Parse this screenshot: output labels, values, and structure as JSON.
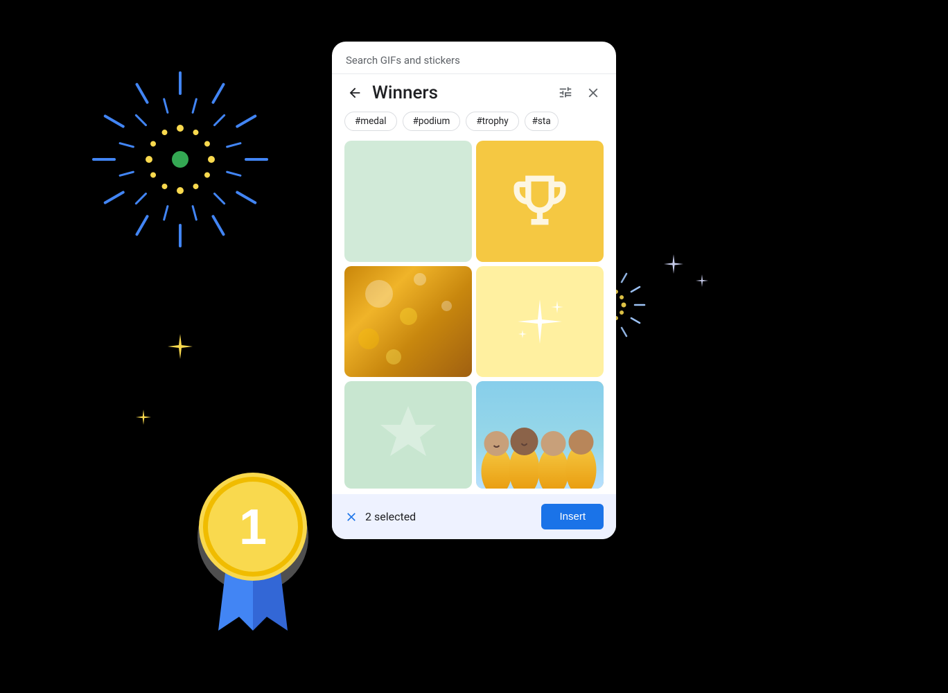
{
  "background": "#000000",
  "modal": {
    "search_header": "Search GIFs and stickers",
    "title": "Winners",
    "tags": [
      "#medal",
      "#podium",
      "#trophy",
      "#sta"
    ],
    "back_label": "←",
    "filter_icon": "filter-icon",
    "close_icon": "close-icon",
    "grid_cells": [
      {
        "id": "cell-1",
        "type": "mint-empty",
        "label": "mint background"
      },
      {
        "id": "cell-2",
        "type": "yellow-trophy",
        "label": "trophy"
      },
      {
        "id": "cell-3",
        "type": "gold-bokeh",
        "label": "gold bokeh"
      },
      {
        "id": "cell-4",
        "type": "yellow-sparkles",
        "label": "sparkles"
      },
      {
        "id": "cell-5",
        "type": "mint-star",
        "label": "star"
      },
      {
        "id": "cell-6",
        "type": "photo-team",
        "label": "team photo"
      }
    ]
  },
  "bottom_bar": {
    "selected_count": "2 selected",
    "insert_label": "Insert",
    "clear_icon": "x-icon"
  },
  "decorations": {
    "starburst_blue_color": "#4285F4",
    "starburst_center_color": "#F9D94E",
    "medal_number": "1",
    "sparkle_color": "#F9D94E"
  }
}
